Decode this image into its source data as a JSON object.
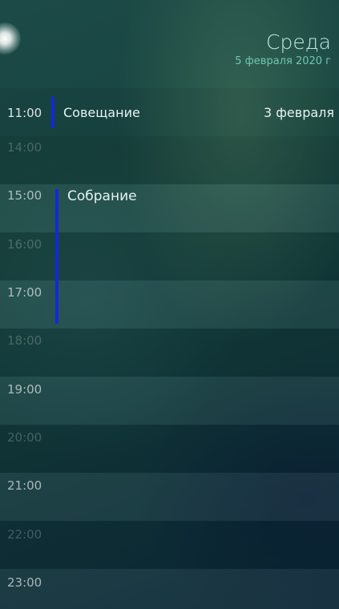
{
  "header": {
    "day_name": "Среда",
    "date": "5 февраля 2020 г"
  },
  "timeline": {
    "first_event": {
      "time": "11:00",
      "title": "Совещание",
      "date": "3 февраля"
    },
    "hours": [
      "14:00",
      "15:00",
      "16:00",
      "17:00",
      "18:00",
      "19:00",
      "20:00",
      "21:00",
      "22:00",
      "23:00"
    ],
    "event": {
      "title": "Собрание"
    }
  },
  "colors": {
    "event_bar": "#1428d8",
    "title_accent": "#b9ece1",
    "date_accent": "#6fc6b2"
  }
}
